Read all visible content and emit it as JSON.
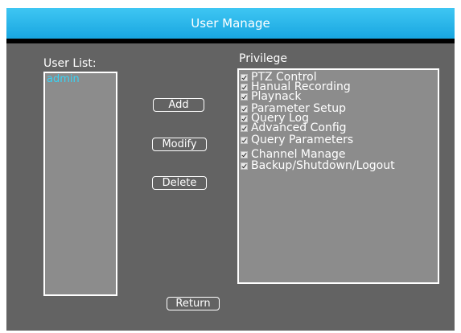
{
  "window": {
    "title": "User Manage"
  },
  "user_list": {
    "label": "User List:",
    "users": [
      "admin"
    ]
  },
  "privilege": {
    "label": "Privilege",
    "items": [
      {
        "label": "PTZ Control",
        "checked": true
      },
      {
        "label": "Hanual Recording",
        "checked": true
      },
      {
        "label": "Playnack",
        "checked": true
      },
      {
        "label": "Parameter Setup",
        "checked": true
      },
      {
        "label": "Query Log",
        "checked": true
      },
      {
        "label": "Advanced Config",
        "checked": true
      },
      {
        "label": "Query Parameters",
        "checked": true
      },
      {
        "label": "Channel Manage",
        "checked": true
      },
      {
        "label": "Backup/Shutdown/Logout",
        "checked": true
      }
    ]
  },
  "buttons": {
    "add": "Add",
    "modify": "Modify",
    "delete": "Delete",
    "return": "Return"
  },
  "colors": {
    "title_bar": "#1aa8e2",
    "panel": "#636363",
    "list_bg": "#8c8c8c",
    "user_text": "#39d3f5"
  }
}
